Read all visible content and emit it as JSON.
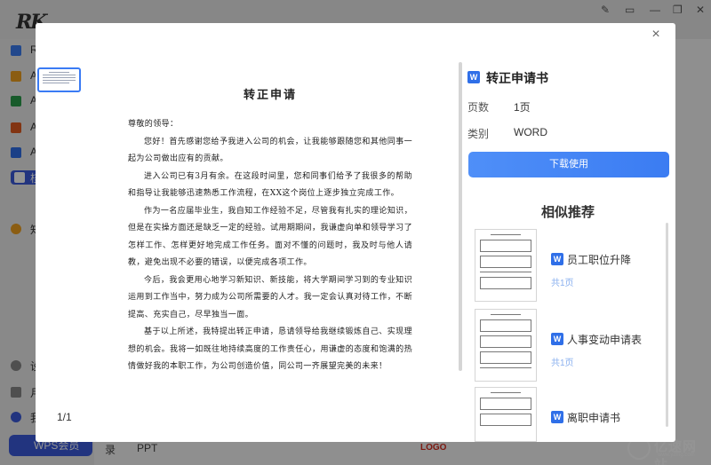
{
  "background": {
    "sidebar_letters": [
      "R",
      "A",
      "A",
      "A",
      "A",
      "核",
      "知"
    ],
    "bottom_sidebar_letters": [
      "设",
      "月",
      "我"
    ],
    "bottom_pill_label": "WPS会员",
    "bottom_tab_1": "录",
    "bottom_tab_2": "PPT",
    "logo_text": "LOGO",
    "watermark_main": "亿速网站",
    "watermark_sub": "www.yzmg.com"
  },
  "modal": {
    "close_label": "×",
    "page_indicator": "1/1",
    "document": {
      "title": "转正申请",
      "salutation": "尊敬的领导：",
      "paragraphs": [
        "您好！首先感谢您给予我进入公司的机会，让我能够跟随您和其他同事一起为公司做出应有的贡献。",
        "进入公司已有3月有余。在这段时间里，您和同事们给予了我很多的帮助和指导让我能够迅速熟悉工作流程，在XX这个岗位上逐步独立完成工作。",
        "作为一名应届毕业生，我自知工作经验不足，尽管我有扎实的理论知识，但是在实操方面还是缺乏一定的经验。试用期期间，我谦虚向单和领导学习了怎样工作、怎样更好地完成工作任务。面对不懂的问题时，我及时与他人请教，避免出现不必要的错误，以便完成各项工作。",
        "今后，我会更用心地学习新知识、新技能，将大学期间学习到的专业知识运用到工作当中，努力成为公司所需要的人才。我一定会认真对待工作，不断提高、充实自己，尽早独当一面。",
        "基于以上所述，我特提出转正申请，恳请领导给我继续锻炼自己、实现理想的机会。我将一如既往地持续高度的工作责任心，用谦虚的态度和饱满的热情做好我的本职工作，为公司创造价值，同公司一齐展望完美的未来！"
      ]
    },
    "panel": {
      "file_icon_label": "W",
      "title": "转正申请书",
      "pages_label": "页数",
      "pages_value": "1页",
      "type_label": "类别",
      "type_value": "WORD",
      "download_label": "下载使用",
      "similar_title": "相似推荐",
      "recommendations": [
        {
          "name": "员工职位升降",
          "pages": "共1页"
        },
        {
          "name": "人事变动申请表",
          "pages": "共1页"
        },
        {
          "name": "离职申请书",
          "pages": ""
        }
      ]
    }
  }
}
